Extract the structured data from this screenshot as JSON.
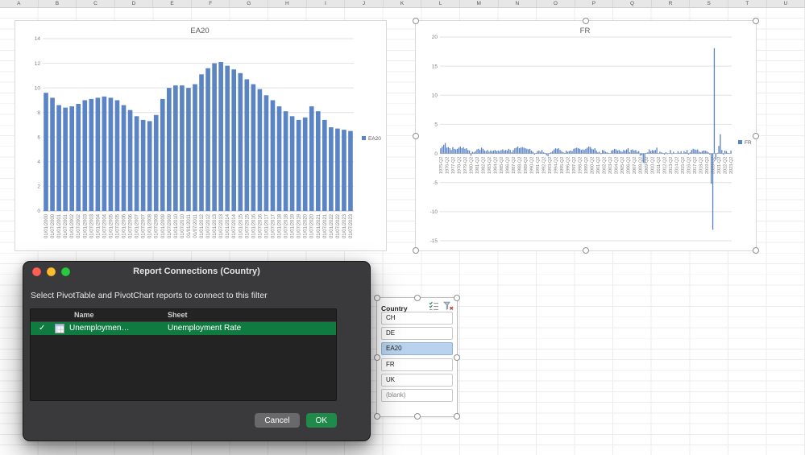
{
  "sheet": {
    "column_headers": [
      "A",
      "B",
      "C",
      "D",
      "E",
      "F",
      "G",
      "H",
      "I",
      "J",
      "K",
      "L",
      "M",
      "N",
      "O",
      "P",
      "Q",
      "R",
      "S",
      "T",
      "U"
    ]
  },
  "chart_data": [
    {
      "type": "bar",
      "title": "EA20",
      "series_name": "EA20",
      "legend_position": "right",
      "xlabel": "",
      "ylabel": "",
      "ylim": [
        0,
        14
      ],
      "yticks": [
        0,
        2,
        4,
        6,
        8,
        10,
        12,
        14
      ],
      "grid": true,
      "bar_color": "#5b84c4",
      "label_interval": 1,
      "categories": [
        "01/01/2000",
        "01/07/2000",
        "01/01/2001",
        "01/07/2001",
        "01/01/2002",
        "01/07/2002",
        "01/01/2003",
        "01/07/2003",
        "01/01/2004",
        "01/07/2004",
        "01/01/2005",
        "01/07/2005",
        "01/01/2006",
        "01/07/2006",
        "01/01/2007",
        "01/07/2007",
        "01/01/2008",
        "01/07/2008",
        "01/01/2009",
        "01/07/2009",
        "01/01/2010",
        "01/07/2010",
        "01/01/2011",
        "01/07/2011",
        "01/01/2012",
        "01/07/2012",
        "01/01/2013",
        "01/07/2013",
        "01/01/2014",
        "01/07/2014",
        "01/01/2015",
        "01/07/2015",
        "01/01/2016",
        "01/07/2016",
        "01/01/2017",
        "01/07/2017",
        "01/01/2018",
        "01/07/2018",
        "01/01/2019",
        "01/07/2019",
        "01/01/2020",
        "01/07/2020",
        "01/01/2021",
        "01/07/2021",
        "01/01/2022",
        "01/07/2022",
        "01/01/2023",
        "01/07/2023"
      ],
      "values": [
        9.6,
        9.2,
        8.6,
        8.4,
        8.5,
        8.7,
        9.0,
        9.1,
        9.2,
        9.3,
        9.2,
        9.0,
        8.6,
        8.2,
        7.7,
        7.4,
        7.3,
        7.8,
        9.1,
        10.0,
        10.2,
        10.2,
        10.0,
        10.3,
        11.1,
        11.6,
        12.0,
        12.1,
        11.8,
        11.5,
        11.2,
        10.7,
        10.3,
        9.9,
        9.4,
        9.0,
        8.5,
        8.1,
        7.7,
        7.4,
        7.6,
        8.5,
        8.1,
        7.4,
        6.8,
        6.7,
        6.6,
        6.5
      ]
    },
    {
      "type": "bar",
      "title": "FR",
      "series_name": "FR",
      "legend_position": "right",
      "xlabel": "",
      "ylabel": "",
      "ylim": [
        -15,
        20
      ],
      "yticks": [
        -15,
        -10,
        -5,
        0,
        5,
        10,
        15,
        20
      ],
      "grid": true,
      "bar_color": "#5b84c4",
      "label_interval": 4,
      "categories": [
        "1975-Q2",
        "1976-Q2",
        "1977-Q2",
        "1978-Q2",
        "1979-Q2",
        "1980-Q2",
        "1981-Q2",
        "1982-Q2",
        "1983-Q2",
        "1984-Q2",
        "1985-Q2",
        "1986-Q2",
        "1987-Q2",
        "1988-Q2",
        "1989-Q2",
        "1990-Q2",
        "1991-Q2",
        "1992-Q2",
        "1993-Q2",
        "1994-Q2",
        "1995-Q2",
        "1996-Q2",
        "1997-Q2",
        "1998-Q2",
        "1999-Q2",
        "2000-Q2",
        "2001-Q2",
        "2002-Q2",
        "2003-Q2",
        "2004-Q2",
        "2005-Q2",
        "2006-Q2",
        "2007-Q2",
        "2008-Q2",
        "2009-Q2",
        "2010-Q2",
        "2011-Q2",
        "2012-Q2",
        "2013-Q2",
        "2014-Q2",
        "2015-Q2",
        "2016-Q2",
        "2017-Q2",
        "2018-Q2",
        "2019-Q2",
        "2020-Q2",
        "2021-Q2",
        "2022-Q2",
        "2023-Q2"
      ],
      "values": [
        0.9,
        1.2,
        1.5,
        1.8,
        1.0,
        1.1,
        0.9,
        0.6,
        1.1,
        0.8,
        0.7,
        0.8,
        1.0,
        1.2,
        0.9,
        1.1,
        0.8,
        0.9,
        0.6,
        0.5,
        -0.4,
        0.3,
        0.2,
        0.4,
        0.7,
        0.8,
        0.6,
        1.0,
        0.8,
        0.5,
        0.4,
        0.6,
        0.3,
        0.5,
        0.4,
        0.5,
        0.6,
        0.4,
        0.5,
        0.4,
        0.6,
        0.7,
        0.5,
        0.6,
        0.5,
        0.8,
        0.6,
        0.2,
        0.6,
        0.9,
        1.0,
        1.2,
        0.9,
        1.0,
        1.1,
        1.0,
        0.9,
        0.8,
        0.7,
        0.8,
        0.5,
        0.3,
        -0.2,
        0.1,
        0.4,
        0.5,
        0.3,
        0.6,
        0.2,
        0.1,
        -0.3,
        -0.5,
        0.1,
        0.2,
        0.4,
        0.7,
        0.9,
        0.8,
        0.9,
        0.6,
        0.4,
        0.2,
        0.1,
        0.5,
        0.3,
        0.4,
        0.5,
        0.4,
        0.8,
        0.9,
        1.0,
        0.9,
        0.8,
        0.6,
        0.7,
        0.6,
        0.8,
        1.0,
        1.2,
        1.1,
        0.8,
        0.7,
        0.9,
        0.5,
        0.2,
        0.3,
        -0.1,
        0.6,
        0.5,
        0.3,
        0.2,
        0.1,
        0.0,
        0.5,
        0.6,
        0.8,
        0.7,
        0.5,
        0.6,
        0.4,
        0.3,
        0.6,
        0.5,
        0.7,
        0.9,
        0.2,
        0.6,
        0.7,
        0.5,
        0.6,
        0.3,
        0.4,
        -0.4,
        -0.3,
        -1.6,
        -1.7,
        0.1,
        0.2,
        0.7,
        0.4,
        0.6,
        0.5,
        0.6,
        1.0,
        0.0,
        0.3,
        0.2,
        0.1,
        -0.2,
        0.2,
        -0.1,
        0.0,
        0.6,
        -0.1,
        0.3,
        0.0,
        0.0,
        0.4,
        0.1,
        0.4,
        0.0,
        0.4,
        0.2,
        0.6,
        -0.2,
        0.2,
        0.6,
        0.8,
        0.7,
        0.6,
        0.7,
        0.3,
        0.2,
        0.4,
        0.5,
        0.5,
        0.4,
        0.2,
        -0.2,
        -5.2,
        -13.1,
        18.1,
        -1.1,
        0.1,
        1.3,
        3.3,
        0.6,
        -0.2,
        0.5,
        0.4,
        0.1,
        0.0,
        0.5
      ]
    }
  ],
  "dialog": {
    "title": "Report Connections (Country)",
    "description": "Select PivotTable and PivotChart reports to connect to this filter",
    "window_controls": [
      "close",
      "minimize",
      "zoom"
    ],
    "columns": [
      "Name",
      "Sheet"
    ],
    "rows": [
      {
        "checked": true,
        "check": "✓",
        "name": "Unemploymen…",
        "sheet": "Unemployment Rate",
        "icon": "pivot-table-icon"
      }
    ],
    "buttons": {
      "cancel": "Cancel",
      "ok": "OK"
    }
  },
  "slicer": {
    "title": "Country",
    "icons": [
      "multi-select-icon",
      "clear-filter-icon"
    ],
    "items": [
      {
        "label": "CH",
        "selected": false
      },
      {
        "label": "DE",
        "selected": false
      },
      {
        "label": "EA20",
        "selected": true
      },
      {
        "label": "FR",
        "selected": false
      },
      {
        "label": "UK",
        "selected": false
      },
      {
        "label": "(blank)",
        "selected": false
      }
    ]
  },
  "colors": {
    "bar_blue": "#5b84c4",
    "dialog_selection_green": "#0f7b40",
    "ok_button_green": "#1f8a4a",
    "slicer_selected_fill": "#b9d3ee",
    "traffic_lights": [
      "#ff5f57",
      "#febc2e",
      "#28c840"
    ]
  }
}
